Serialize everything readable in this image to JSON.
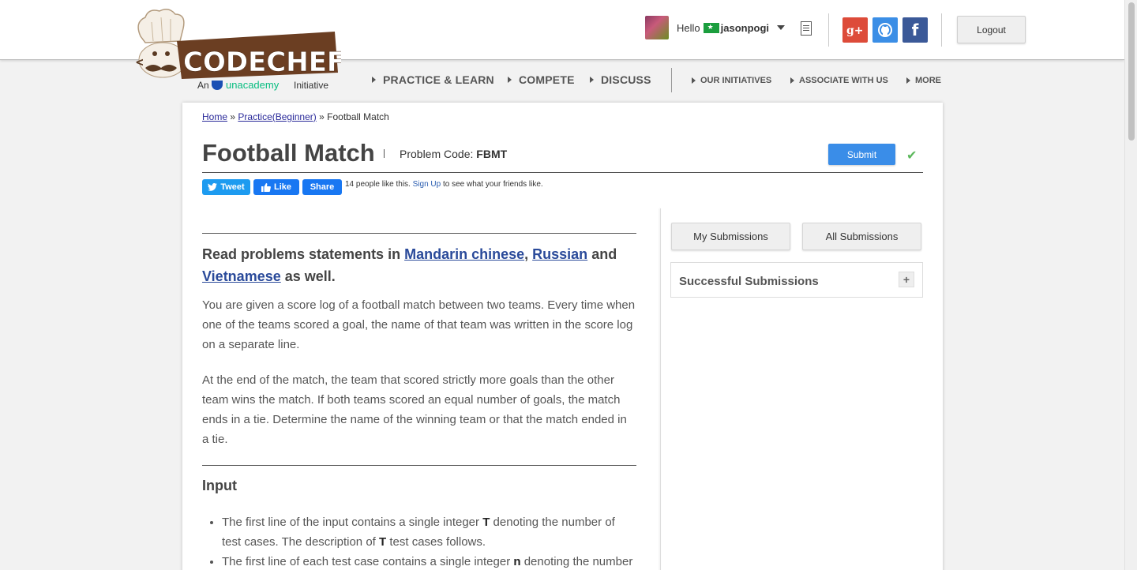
{
  "header": {
    "brand": "CODECHEF",
    "tagline_prefix": "An",
    "tagline_partner": "unacademy",
    "tagline_suffix": "Initiative",
    "greeting": "Hello",
    "username": "jasonpogi",
    "logout_label": "Logout",
    "social": {
      "gplus": "g+",
      "github": "gh",
      "facebook": "f"
    }
  },
  "nav": {
    "main": [
      "PRACTICE & LEARN",
      "COMPETE",
      "DISCUSS"
    ],
    "secondary": [
      "OUR INITIATIVES",
      "ASSOCIATE WITH US",
      "MORE"
    ]
  },
  "breadcrumb": {
    "home": "Home",
    "sep1": "»",
    "practice": "Practice(Beginner)",
    "sep2": "»",
    "current": "Football Match"
  },
  "problem": {
    "title": "Football Match",
    "code_label": "Problem Code:",
    "code": "FBMT",
    "submit_label": "Submit",
    "social_bar": {
      "tweet": "Tweet",
      "like": "Like",
      "share": "Share",
      "likes_text": "14 people like this.",
      "signup": "Sign Up",
      "signup_suffix": "to see what your friends like."
    },
    "lang_intro": "Read problems statements in",
    "lang1": "Mandarin chinese",
    "lang2": "Russian",
    "lang_and": "and",
    "lang3": "Vietnamese",
    "lang_suffix": "as well.",
    "para1": "You are given a score log of a football match between two teams. Every time when one of the teams scored a goal, the name of that team was written in the score log on a separate line.",
    "para2": "At the end of the match, the team that scored strictly more goals than the other team wins the match. If both teams scored an equal number of goals, the match ends in a tie. Determine the name of the winning team or that the match ended in a tie.",
    "input_title": "Input",
    "bullet1_a": "The first line of the input contains a single integer",
    "bullet1_b": "T",
    "bullet1_c": "denoting the number of test cases. The description of",
    "bullet1_d": "T",
    "bullet1_e": "test cases follows.",
    "bullet2_a": "The first line of each test case contains a single integer",
    "bullet2_b": "n",
    "bullet2_c": "denoting the number"
  },
  "sidebar": {
    "my_submissions": "My Submissions",
    "all_submissions": "All Submissions",
    "successful_submissions": "Successful Submissions",
    "expand": "+"
  }
}
